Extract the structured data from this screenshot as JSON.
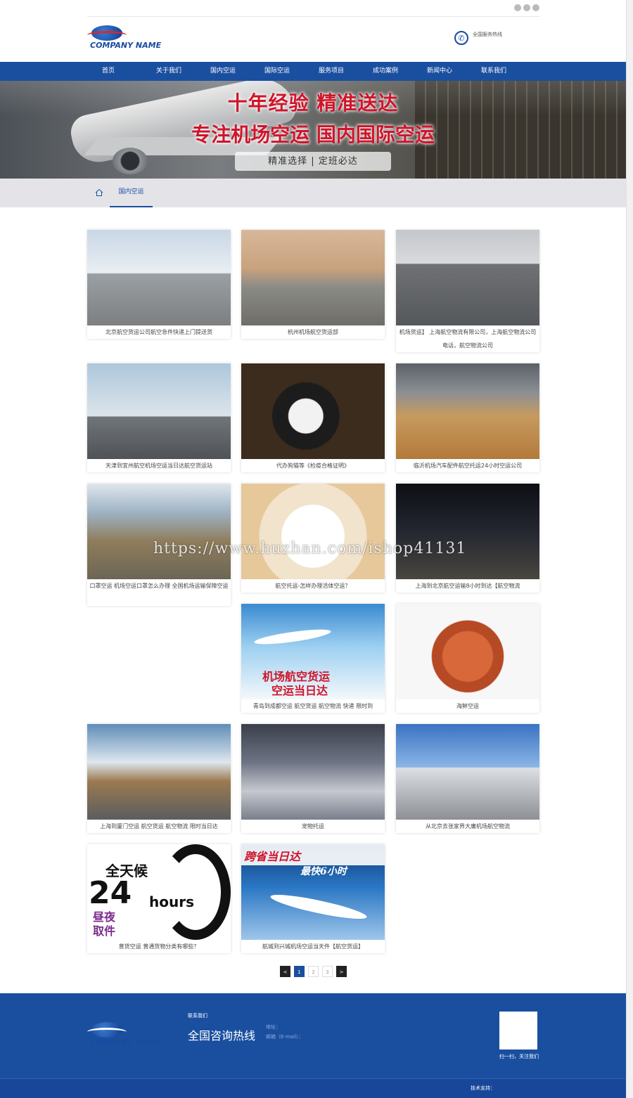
{
  "header": {
    "company_name": "COMPANY NAME",
    "hotline_label": "全国服务热线"
  },
  "nav": {
    "items": [
      "首页",
      "关于我们",
      "国内空运",
      "国际空运",
      "服务项目",
      "成功案例",
      "新闻中心",
      "联系我们"
    ]
  },
  "banner": {
    "title_line1": "十年经验 精准送达",
    "title_line2": "专注机场空运 国内国际空运",
    "tagline": "精准选择 | 定班必达"
  },
  "breadcrumb": {
    "current": "国内空运"
  },
  "products": [
    {
      "caption": "北京航空货运公司航空急件快递上门提送货"
    },
    {
      "caption": "杭州机场航空货运部"
    },
    {
      "caption": "机场货运】 上海航空物流有限公司，上海航空物流公司电话，航空物流公司"
    },
    {
      "caption": "天津到宜州航空机场空运当日达航空货运站"
    },
    {
      "caption": "代办狗猫等《检疫合格证明》"
    },
    {
      "caption": "临沂机场汽车配件航空托运24小时空运公司"
    },
    {
      "caption": "口罩空运 机场空运口罩怎么办理 全国机场运输保障空运"
    },
    {
      "caption": "航空托运-怎样办理活体空运？"
    },
    {
      "caption": "上海到北京航空运输8小时到达【航空物流"
    },
    {
      "caption": "青岛到成都空运 航空货运 航空物流 快递 限时到"
    },
    {
      "caption": "海鲜空运"
    },
    {
      "caption": "上海到厦门空运 航空货运 航空物流 限时当日达"
    },
    {
      "caption": "宠物托运"
    },
    {
      "caption": "从北京去张家界大庸机场航空物流"
    },
    {
      "caption": "普货空运 普通货物分类有哪些？"
    },
    {
      "caption": "航城到兴城机场空运当天件【航空货运】"
    }
  ],
  "promo_images": {
    "airfreight_line1": "机场航空货运",
    "airfreight_line2": "空运当日达",
    "clock_top": "全天候",
    "clock_num": "24",
    "clock_hours": "hours",
    "clock_bottom1": "昼夜",
    "clock_bottom2": "取件",
    "sameday_title": "跨省当日达",
    "sameday_sub": "最快6小时"
  },
  "pagination": {
    "prev": "<",
    "pages": [
      "1",
      "2",
      "3"
    ],
    "next": ">"
  },
  "watermark": "https://www.huzhan.com/ishop41131",
  "footer": {
    "contact_title": "联系我们",
    "hotline": "全国咨询热线",
    "address_label": "地址：",
    "email_label": "邮箱（E-mail）：",
    "qr_caption": "扫一扫，关注我们",
    "tech_support": "技术支持："
  },
  "colors": {
    "brand_blue": "#1a4fa0",
    "banner_red": "#d0142a"
  }
}
